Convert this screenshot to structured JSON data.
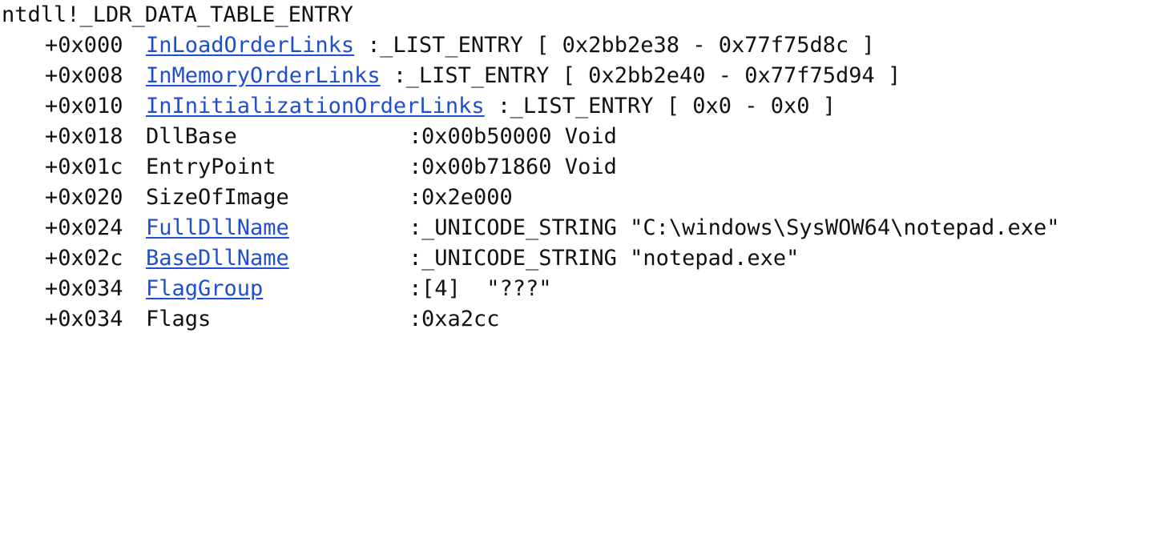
{
  "title": "ntdll!_LDR_DATA_TABLE_ENTRY",
  "fields": [
    {
      "offset": "+0x000",
      "name": "InLoadOrderLinks",
      "link": true,
      "value": "_LIST_ENTRY [ 0x2bb2e38 - 0x77f75d8c ]"
    },
    {
      "offset": "+0x008",
      "name": "InMemoryOrderLinks",
      "link": true,
      "value": "_LIST_ENTRY [ 0x2bb2e40 - 0x77f75d94 ]"
    },
    {
      "offset": "+0x010",
      "name": "InInitializationOrderLinks",
      "link": true,
      "value": "_LIST_ENTRY [ 0x0 - 0x0 ]"
    },
    {
      "offset": "+0x018",
      "name": "DllBase",
      "link": false,
      "value": "0x00b50000 Void"
    },
    {
      "offset": "+0x01c",
      "name": "EntryPoint",
      "link": false,
      "value": "0x00b71860 Void"
    },
    {
      "offset": "+0x020",
      "name": "SizeOfImage",
      "link": false,
      "value": "0x2e000"
    },
    {
      "offset": "+0x024",
      "name": "FullDllName",
      "link": true,
      "value": "_UNICODE_STRING \"C:\\windows\\SysWOW64\\notepad.exe\""
    },
    {
      "offset": "+0x02c",
      "name": "BaseDllName",
      "link": true,
      "value": "_UNICODE_STRING \"notepad.exe\""
    },
    {
      "offset": "+0x034",
      "name": "FlagGroup",
      "link": true,
      "value": "[4]  \"???\""
    },
    {
      "offset": "+0x034",
      "name": "Flags",
      "link": false,
      "value": "0xa2cc"
    }
  ],
  "colors": {
    "text": "#111111",
    "link": "#1f4fd1",
    "background": "#ffffff"
  }
}
